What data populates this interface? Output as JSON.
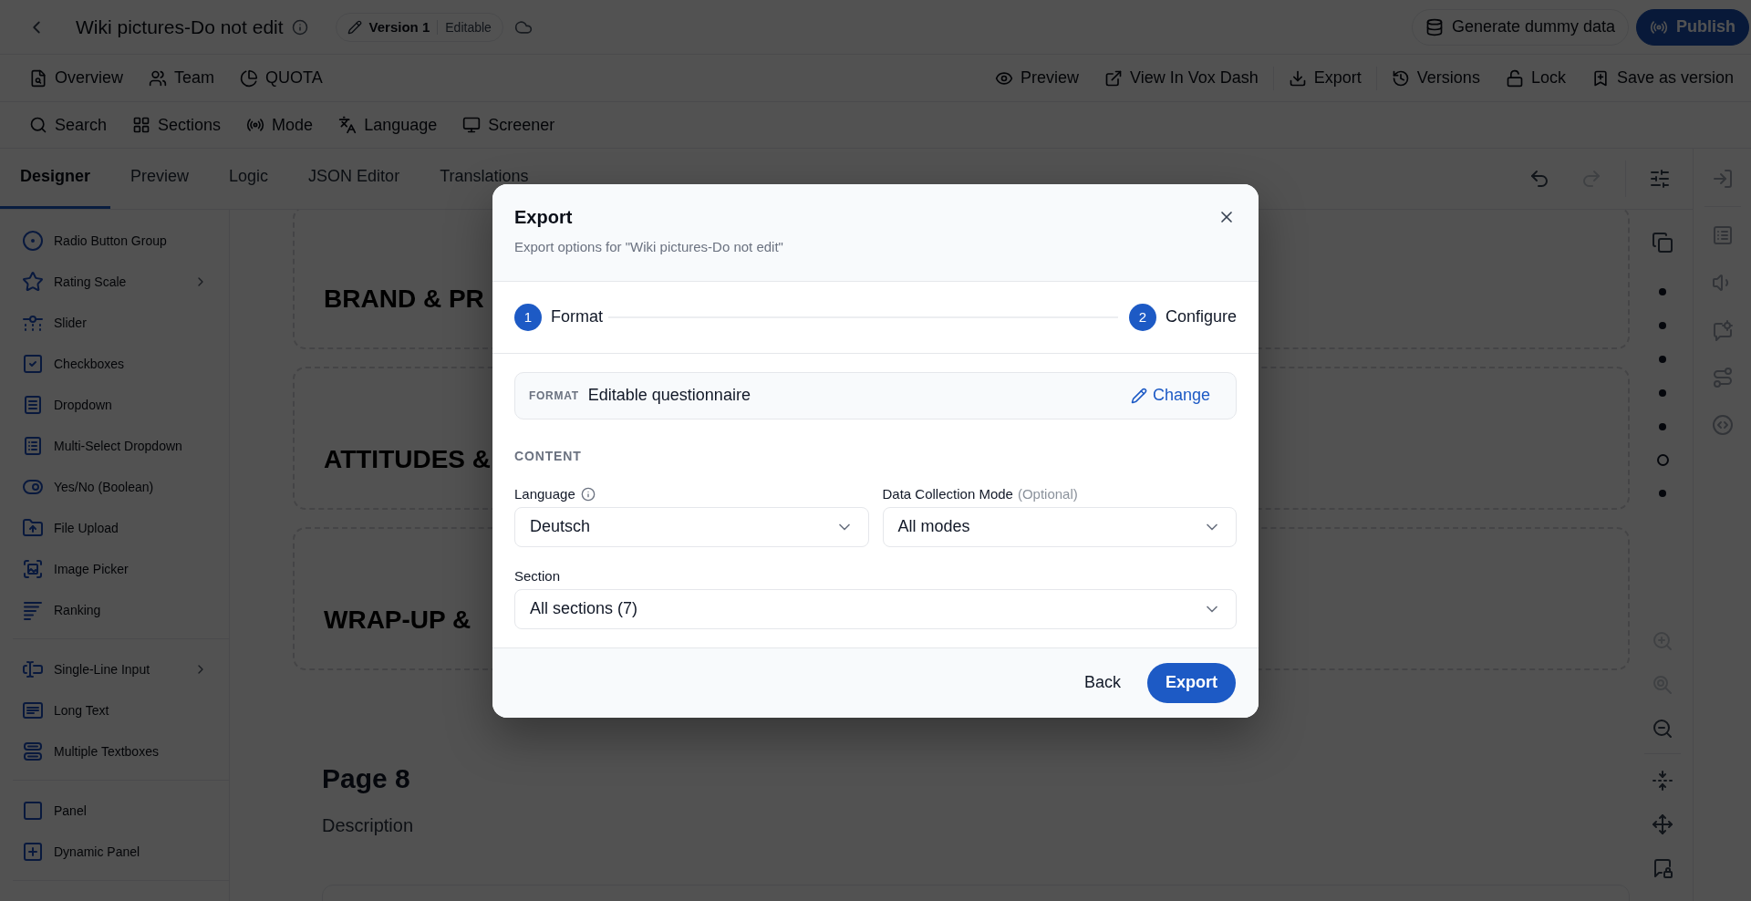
{
  "header": {
    "title": "Wiki pictures-Do not edit",
    "version": {
      "label": "Version 1",
      "status": "Editable"
    },
    "actions": [
      {
        "label": "Generate dummy data",
        "kind": "outline"
      },
      {
        "label": "Publish",
        "kind": "primary"
      }
    ]
  },
  "nav": {
    "left": [
      {
        "label": "Overview"
      },
      {
        "label": "Team"
      },
      {
        "label": "QUOTA"
      }
    ],
    "right_groups": [
      [
        {
          "label": "Preview"
        },
        {
          "label": "View In Vox Dash"
        }
      ],
      [
        {
          "label": "Export"
        }
      ],
      [
        {
          "label": "Versions"
        },
        {
          "label": "Lock"
        },
        {
          "label": "Save as version"
        }
      ]
    ]
  },
  "toolbar": [
    {
      "label": "Search"
    },
    {
      "label": "Sections"
    },
    {
      "label": "Mode"
    },
    {
      "label": "Language"
    },
    {
      "label": "Screener"
    }
  ],
  "tabs": [
    {
      "label": "Designer",
      "selected": true
    },
    {
      "label": "Preview",
      "selected": false
    },
    {
      "label": "Logic",
      "selected": false
    },
    {
      "label": "JSON Editor",
      "selected": false
    },
    {
      "label": "Translations",
      "selected": false
    }
  ],
  "history": [
    {
      "kind": "undo",
      "disabled": false
    },
    {
      "kind": "redo",
      "disabled": true
    }
  ],
  "sidebar": {
    "groups": [
      {
        "items": [
          {
            "label": "Radio Button Group",
            "has_submenu": false
          },
          {
            "label": "Rating Scale",
            "has_submenu": true
          },
          {
            "label": "Slider",
            "has_submenu": false
          },
          {
            "label": "Checkboxes",
            "has_submenu": false
          },
          {
            "label": "Dropdown",
            "has_submenu": false
          },
          {
            "label": "Multi-Select Dropdown",
            "has_submenu": false
          },
          {
            "label": "Yes/No (Boolean)",
            "has_submenu": false
          },
          {
            "label": "File Upload",
            "has_submenu": false
          },
          {
            "label": "Image Picker",
            "has_submenu": false
          },
          {
            "label": "Ranking",
            "has_submenu": false
          }
        ]
      },
      {
        "items": [
          {
            "label": "Single-Line Input",
            "has_submenu": true
          },
          {
            "label": "Long Text",
            "has_submenu": false
          },
          {
            "label": "Multiple Textboxes",
            "has_submenu": false
          }
        ]
      },
      {
        "items": [
          {
            "label": "Panel",
            "has_submenu": false
          },
          {
            "label": "Dynamic Panel",
            "has_submenu": false
          }
        ]
      }
    ]
  },
  "canvas": {
    "sections": [
      {
        "title": "BRAND & PR"
      },
      {
        "title": "ATTITUDES &"
      },
      {
        "title": "WRAP-UP &"
      }
    ],
    "page": {
      "title": "Page 8",
      "description": "Description"
    }
  },
  "canvas_tools": {
    "page_dots": [
      {
        "selected": false
      },
      {
        "selected": false
      },
      {
        "selected": false
      },
      {
        "selected": false
      },
      {
        "selected": false
      },
      {
        "selected": true
      },
      {
        "selected": false
      }
    ],
    "zoom": [
      {
        "kind": "zoom_in",
        "disabled": true
      },
      {
        "kind": "reset",
        "disabled": true
      },
      {
        "kind": "zoom_out",
        "disabled": false
      }
    ]
  },
  "modal": {
    "title": "Export",
    "subtitle": "Export options for \"Wiki pictures-Do not edit\"",
    "steps": [
      {
        "number": "1",
        "label": "Format"
      },
      {
        "number": "2",
        "label": "Configure"
      }
    ],
    "format": {
      "label": "FORMAT",
      "value": "Editable questionnaire",
      "action": "Change"
    },
    "section_heading": "CONTENT",
    "field_rows": [
      [
        {
          "label": "Language",
          "info": true,
          "value": "Deutsch"
        },
        {
          "label": "Data Collection Mode",
          "hint": "(Optional)",
          "info": false,
          "value": "All modes"
        }
      ],
      [
        {
          "label": "Section",
          "info": false,
          "value": "All sections (7)"
        }
      ]
    ],
    "buttons": [
      {
        "label": "Back",
        "kind": "secondary"
      },
      {
        "label": "Export",
        "kind": "primary"
      }
    ]
  }
}
